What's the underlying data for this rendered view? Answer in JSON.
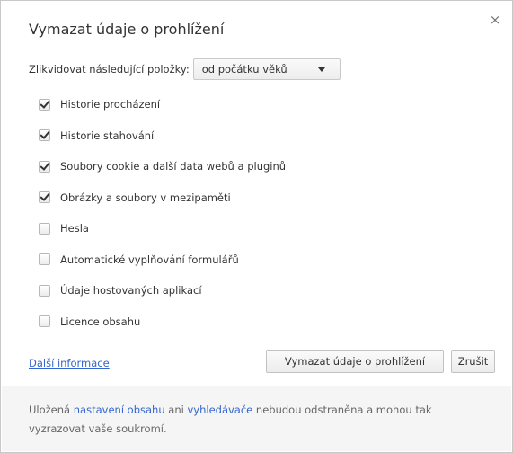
{
  "dialog": {
    "title": "Vymazat údaje o prohlížení",
    "close_glyph": "×"
  },
  "range": {
    "label": "Zlikvidovat následující položky:",
    "selected": "od počátku věků"
  },
  "items": [
    {
      "label": "Historie procházení",
      "checked": true
    },
    {
      "label": "Historie stahování",
      "checked": true
    },
    {
      "label": "Soubory cookie a další data webů a pluginů",
      "checked": true
    },
    {
      "label": "Obrázky a soubory v mezipaměti",
      "checked": true
    },
    {
      "label": "Hesla",
      "checked": false
    },
    {
      "label": "Automatické vyplňování formulářů",
      "checked": false
    },
    {
      "label": "Údaje hostovaných aplikací",
      "checked": false
    },
    {
      "label": "Licence obsahu",
      "checked": false
    }
  ],
  "actions": {
    "more_info": "Další informace",
    "clear": "Vymazat údaje o prohlížení",
    "cancel": "Zrušit"
  },
  "footer": {
    "text_1": "Uložená ",
    "link_content_settings": "nastavení obsahu",
    "text_2": " ani ",
    "link_search_engines": "vyhledávače",
    "text_3": " nebudou odstraněna a mohou tak vyzrazovat vaše soukromí."
  },
  "colors": {
    "link": "#3366cc",
    "footer_bg": "#f5f5f5"
  }
}
